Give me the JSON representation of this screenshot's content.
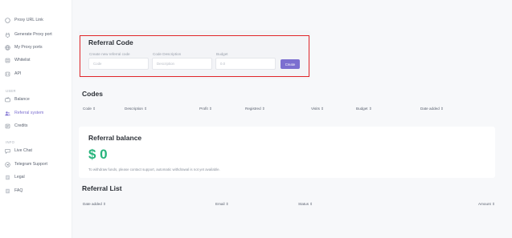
{
  "sidebar": {
    "items": [
      {
        "label": "Proxy URL Link",
        "icon": "link-icon"
      },
      {
        "label": "Generate Proxy port",
        "icon": "plug-icon"
      },
      {
        "label": "My Proxy ports",
        "icon": "globe-icon"
      },
      {
        "label": "Whitelist",
        "icon": "list-icon"
      },
      {
        "label": "API",
        "icon": "code-icon"
      }
    ],
    "section_user": "USER",
    "user_items": [
      {
        "label": "Balance",
        "icon": "wallet-icon"
      },
      {
        "label": "Referral system",
        "icon": "users-icon"
      },
      {
        "label": "Credits",
        "icon": "card-icon"
      }
    ],
    "section_info": "INFO",
    "info_items": [
      {
        "label": "Live Chat",
        "icon": "chat-icon"
      },
      {
        "label": "Telegram Support",
        "icon": "telegram-icon"
      },
      {
        "label": "Legal",
        "icon": "doc-icon"
      },
      {
        "label": "FAQ",
        "icon": "question-icon"
      }
    ]
  },
  "referral_code": {
    "title": "Referral Code",
    "create_label": "Create new referral code",
    "create_placeholder": "Code",
    "desc_label": "Code Description",
    "desc_placeholder": "Description",
    "budget_label": "Budget",
    "budget_placeholder": "0.0",
    "create_button": "Create"
  },
  "codes": {
    "title": "Codes",
    "columns": [
      "Code ⇕",
      "Description ⇕",
      "Profit ⇕",
      "Registred ⇕",
      "Visits ⇕",
      "Budget ⇕",
      "Date added ⇕"
    ]
  },
  "referral_balance": {
    "title": "Referral balance",
    "amount": "$ 0",
    "note": "To withdraw funds, please contact support, automatic withdrawal is not yet available."
  },
  "referral_list": {
    "title": "Referral List",
    "columns": [
      "Date added ⇕",
      "Email ⇕",
      "Status ⇕",
      "Amount ⇕"
    ]
  },
  "colors": {
    "accent": "#7c6fd0",
    "highlight": "#e0262a",
    "balance": "#27b47c"
  }
}
